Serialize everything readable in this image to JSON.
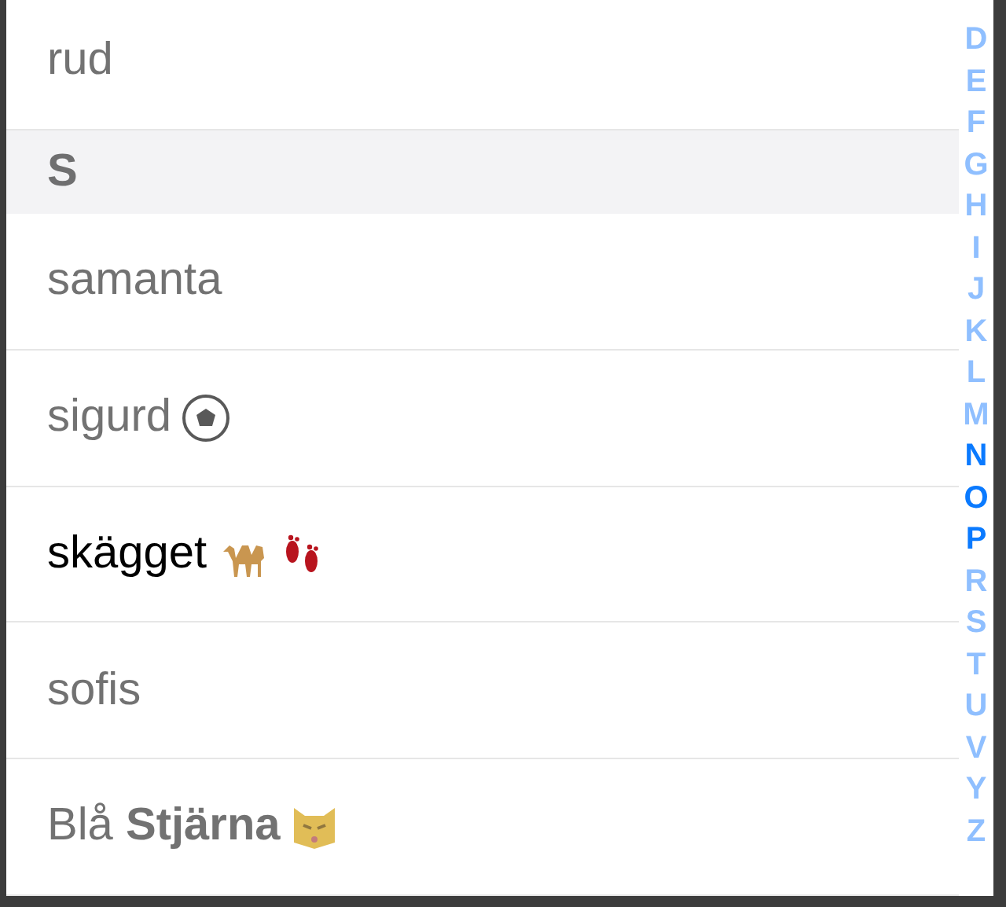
{
  "list": [
    {
      "kind": "row",
      "name": "rud",
      "blurred": true
    },
    {
      "kind": "header",
      "name": "S",
      "blurred": true
    },
    {
      "kind": "row",
      "name": "samanta",
      "blurred": true
    },
    {
      "kind": "row",
      "name": "sigurd",
      "icons": [
        {
          "kind": "ball"
        }
      ],
      "blurred": true
    },
    {
      "kind": "row",
      "name": "skägget",
      "icons": [
        {
          "kind": "camel"
        },
        {
          "kind": "footprints"
        }
      ],
      "blurred": false
    },
    {
      "kind": "row",
      "name": "sofis",
      "blurred": true
    },
    {
      "kind": "row",
      "name": "Blå **Stjärna**",
      "icons": [
        {
          "kind": "cat"
        }
      ],
      "blurred": true
    }
  ],
  "index": [
    {
      "letter": "D",
      "blurred": true
    },
    {
      "letter": "E",
      "blurred": true
    },
    {
      "letter": "F",
      "blurred": true
    },
    {
      "letter": "G",
      "blurred": true
    },
    {
      "letter": "H",
      "blurred": true
    },
    {
      "letter": "I",
      "blurred": true
    },
    {
      "letter": "J",
      "blurred": true
    },
    {
      "letter": "K",
      "blurred": true
    },
    {
      "letter": "L",
      "blurred": true
    },
    {
      "letter": "M",
      "blurred": true
    },
    {
      "letter": "N",
      "blurred": false
    },
    {
      "letter": "O",
      "blurred": false
    },
    {
      "letter": "P",
      "blurred": false
    },
    {
      "letter": "R",
      "blurred": true
    },
    {
      "letter": "S",
      "blurred": true
    },
    {
      "letter": "T",
      "blurred": true
    },
    {
      "letter": "U",
      "blurred": true
    },
    {
      "letter": "V",
      "blurred": true
    },
    {
      "letter": "Y",
      "blurred": true
    },
    {
      "letter": "Z",
      "blurred": true
    }
  ]
}
